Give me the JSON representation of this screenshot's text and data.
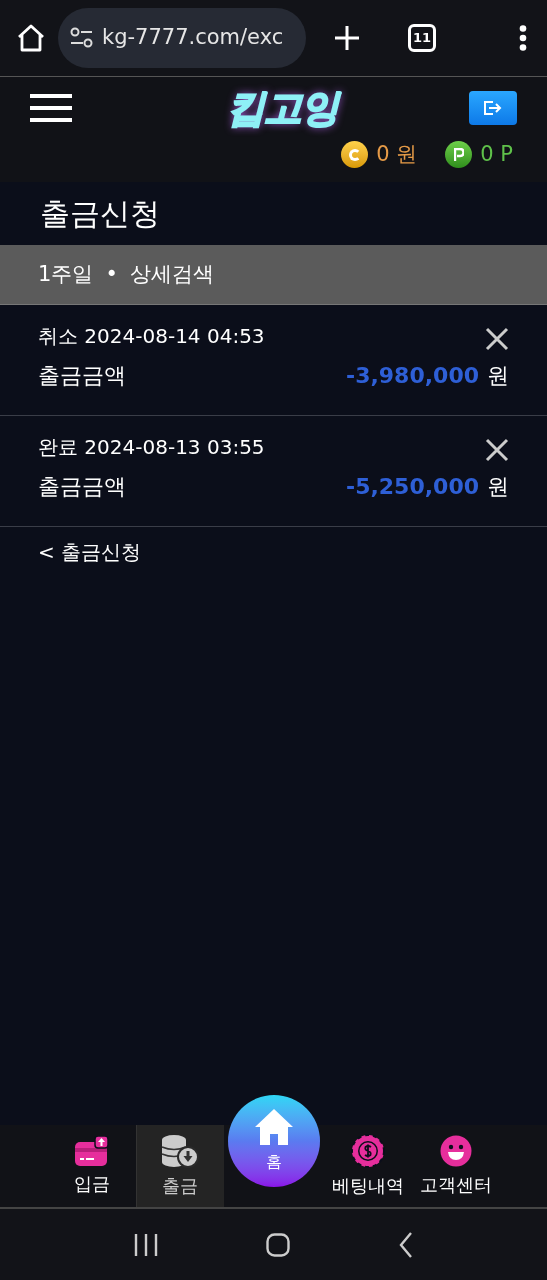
{
  "browser": {
    "url": "kg-7777.com/exc",
    "tab_count": "11"
  },
  "header": {
    "logo": "킵고잉",
    "coin": {
      "value": "0",
      "unit": "원"
    },
    "point": {
      "value": "0",
      "unit": "P"
    }
  },
  "page_title": "출금신청",
  "filter": {
    "period": "1주일",
    "separator": "•",
    "detail": "상세검색"
  },
  "records": [
    {
      "status": "취소",
      "datetime": "2024-08-14 04:53",
      "label": "출금금액",
      "amount": "-3,980,000",
      "unit": "원"
    },
    {
      "status": "완료",
      "datetime": "2024-08-13 03:55",
      "label": "출금금액",
      "amount": "-5,250,000",
      "unit": "원"
    }
  ],
  "back_link": "< 출금신청",
  "bottom_nav": [
    {
      "kind": "deposit",
      "label": "입금",
      "selected": false
    },
    {
      "kind": "withdraw",
      "label": "출금",
      "selected": true
    },
    {
      "kind": "home",
      "label": "홈",
      "selected": false
    },
    {
      "kind": "betting",
      "label": "베팅내역",
      "selected": false
    },
    {
      "kind": "support",
      "label": "고객센터",
      "selected": false
    }
  ]
}
